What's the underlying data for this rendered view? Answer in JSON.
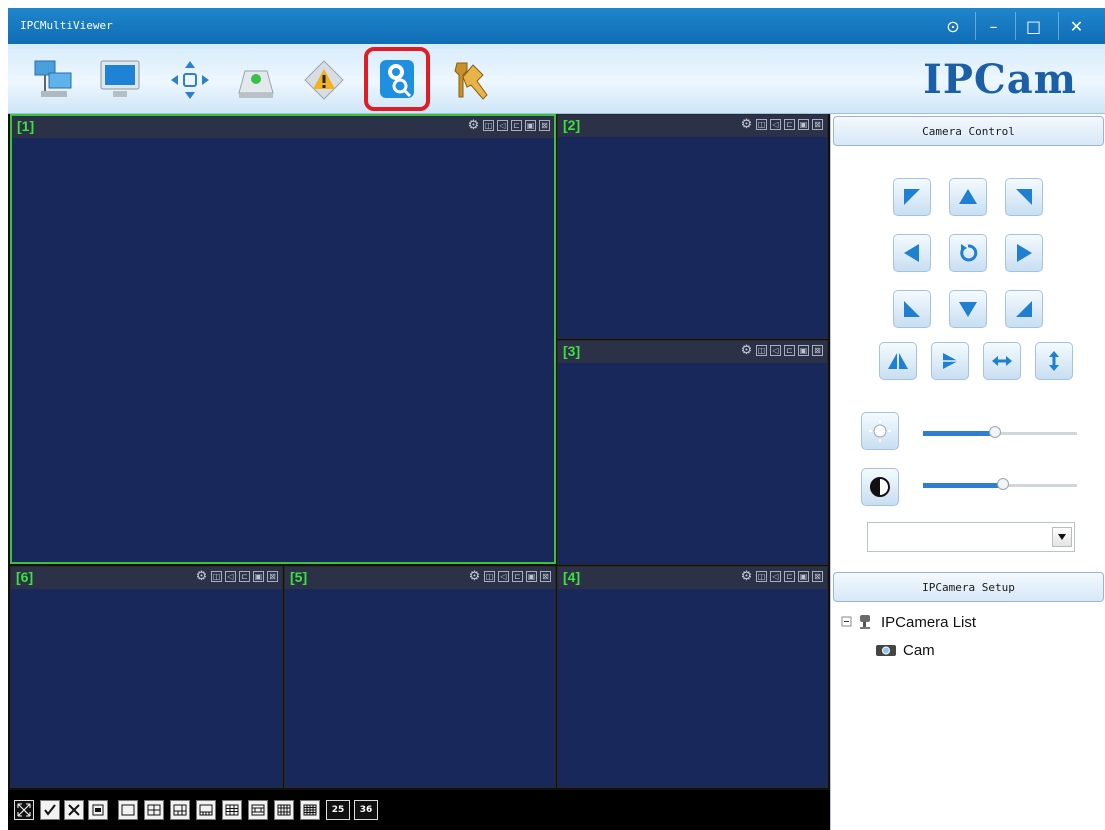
{
  "window": {
    "title": "IPCMultiViewer",
    "controls": [
      "⊙",
      "–",
      "□",
      "✕"
    ]
  },
  "toolbar": {
    "brand": "IPCam"
  },
  "panes": [
    {
      "label": "[1]"
    },
    {
      "label": "[2]"
    },
    {
      "label": "[3]"
    },
    {
      "label": "[6]"
    },
    {
      "label": "[5]"
    },
    {
      "label": "[4]"
    }
  ],
  "pane_controls": {
    "icons": [
      "⚙",
      "◫",
      "◁",
      "⊏",
      "▣",
      "⊠"
    ]
  },
  "layout_buttons": {
    "count_25": "25",
    "count_36": "36"
  },
  "camera_control": {
    "header": "Camera Control",
    "brightness_level": 0.47,
    "contrast_level": 0.52,
    "preset_value": ""
  },
  "setup": {
    "header": "IPCamera Setup",
    "tree_root": "IPCamera List",
    "tree_child": "Cam"
  },
  "colors": {
    "titlebar": "#1478c0",
    "pane_bg": "#18285a",
    "active_border": "#3cc23c",
    "pane_label": "#3ee13e",
    "highlight": "#e01c24"
  }
}
